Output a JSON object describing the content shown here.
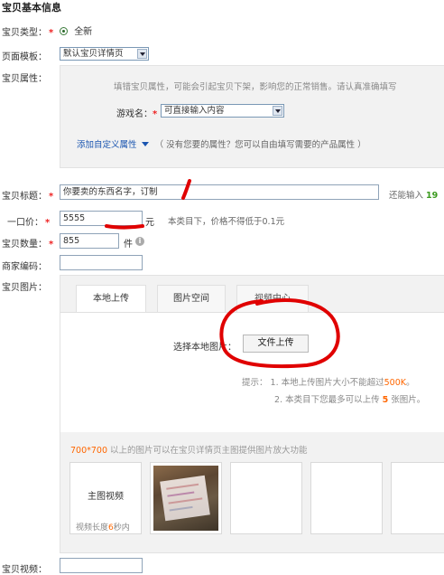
{
  "section_title": "宝贝基本信息",
  "item_type": {
    "label": "宝贝类型：",
    "required_mark": "*",
    "option": "全新"
  },
  "page_template": {
    "label": "页面模板：",
    "value": "默认宝贝详情页"
  },
  "attributes": {
    "label": "宝贝属性：",
    "notice": "填错宝贝属性，可能会引起宝贝下架，影响您的正常销售。请认真准确填写",
    "game_name_label": "游戏名：",
    "game_name_required": "*",
    "game_name_value": "可直接输入内容",
    "add_custom_link": "添加自定义属性",
    "add_custom_hint": "（ 没有您要的属性？您可以自由填写需要的产品属性 ）"
  },
  "item_title": {
    "label": "宝贝标题：",
    "required_mark": "*",
    "value": "你要卖的东西名字，订制",
    "remaining_label": "还能输入",
    "remaining_count": "19"
  },
  "price": {
    "label": "一口价：",
    "required_mark": "*",
    "value": "5555",
    "unit": "元",
    "hint": "本类目下，价格不得低于0.1元"
  },
  "quantity": {
    "label": "宝贝数量：",
    "required_mark": "*",
    "value": "855",
    "unit": "件"
  },
  "merchant_code": {
    "label": "商家编码：",
    "value": ""
  },
  "images": {
    "label": "宝贝图片：",
    "tabs": [
      "本地上传",
      "图片空间",
      "视频中心"
    ],
    "choose_label": "选择本地图片：",
    "upload_button": "文件上传",
    "tip_label": "提示：",
    "tip_1": "1.  本地上传图片大小不能超过",
    "tip_1_limit": "500K",
    "tip_1_end": "。",
    "tip_2_a": "2.  本类目下您最多可以上传",
    "tip_2_count": "5",
    "tip_2_b": "张图片。",
    "zoom_size": "700*700",
    "zoom_text": "以上的图片可以在宝贝详情页主图提供图片放大功能",
    "main_video": "主图视频",
    "video_len_a": "视频长度",
    "video_len_num": "6",
    "video_len_b": "秒内"
  },
  "item_video": {
    "label": "宝贝视频："
  },
  "colors": {
    "required": "#e02020",
    "link": "#1a55b0",
    "highlight": "#ff6600",
    "annotation": "#e00000",
    "count": "#3a9a1e"
  }
}
